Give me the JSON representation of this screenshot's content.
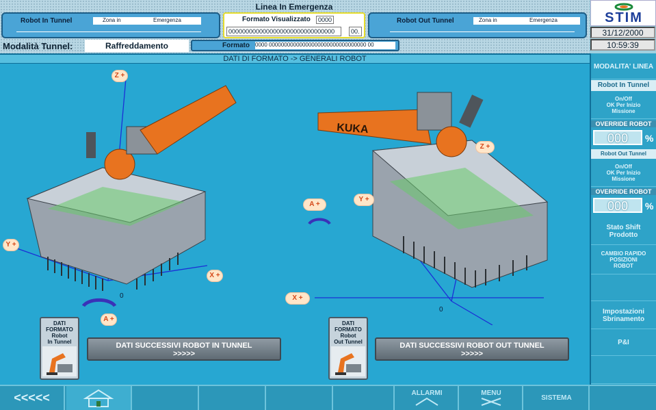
{
  "header": {
    "title": "Linea In Emergenza",
    "robot_in": {
      "label": "Robot In Tunnel",
      "zona": "Zona in",
      "emergenza": "Emergenza"
    },
    "robot_out": {
      "label": "Robot Out Tunnel",
      "zona": "Zona in",
      "emergenza": "Emergenza"
    },
    "formato_visualizzato": {
      "label": "Formato Visualizzato",
      "value": "0000",
      "code": "0000000000000000000000000000000",
      "code_suffix": "00."
    },
    "logo_text": "STIM",
    "date": "31/12/2000",
    "time": "10:59:39",
    "modalita_label": "Modalità Tunnel:",
    "modalita_value": "Raffreddamento",
    "formato_label": "Formato",
    "formato_value": "0000 00000000000000000000000000000000  00"
  },
  "main": {
    "title": "DATI DI FORMATO -> GENERALI ROBOT",
    "left_axes": {
      "z": "Z +",
      "y": "Y +",
      "x": "X +",
      "a": "A +",
      "origin": "0"
    },
    "right_axes": {
      "z": "Z +",
      "y": "Y +",
      "x": "X +",
      "a": "A +",
      "origin": "0"
    },
    "robot_brand": "KUKA",
    "left_card": {
      "l1": "DATI",
      "l2": "FORMATO",
      "l3": "Robot",
      "l4": "In Tunnel"
    },
    "right_card": {
      "l1": "DATI",
      "l2": "FORMATO",
      "l3": "Robot",
      "l4": "Out Tunnel"
    },
    "left_button": {
      "line1": "DATI SUCCESSIVI ROBOT IN TUNNEL",
      "line2": ">>>>>"
    },
    "right_button": {
      "line1": "DATI SUCCESSIVI ROBOT OUT TUNNEL",
      "line2": ">>>>>"
    }
  },
  "sidebar": {
    "modalita_linea": "MODALITA' LINEA",
    "robot_in_header": "Robot In Tunnel",
    "robot_in_status": "On/Off\nOK Per Inizio\nMissione",
    "override1_label": "OVERRIDE ROBOT",
    "override1_value": "000",
    "robot_out_header": "Robot Out Tunnel",
    "robot_out_status": "On/Off\nOK Per Inizio\nMissione",
    "override2_label": "OVERRIDE ROBOT",
    "override2_value": "000",
    "percent": "%",
    "stato_shift": "Stato Shift Prodotto",
    "cambio_rapido": "CAMBIO RAPIDO POSIZIONI ROBOT",
    "impostazioni": "Impostazioni Sbrinamento",
    "pi": "P&I"
  },
  "nav": {
    "back": "<<<<<",
    "allarmi": "ALLARMI",
    "menu": "MENU",
    "sistema": "SISTEMA"
  },
  "colors": {
    "accent": "#2ea3c8",
    "robot_orange": "#e8731f",
    "axis_blue": "#1b2fd6"
  },
  "icons": [
    "home-icon",
    "alarm-icon",
    "menu-icon",
    "rotation-arrow-icon",
    "robot-thumbnail-icon"
  ]
}
